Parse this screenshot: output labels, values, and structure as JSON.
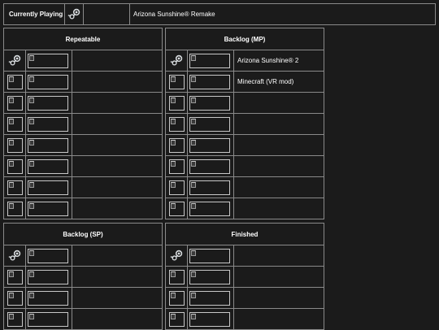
{
  "current": {
    "label": "Currently Playing",
    "icon": "steam-icon",
    "game": "Arizona Sunshine® Remake"
  },
  "sections": {
    "repeatable": {
      "title": "Repeatable",
      "rows": [
        {
          "icon": "steam-icon",
          "title": ""
        },
        {
          "icon": "image-placeholder-icon",
          "title": ""
        },
        {
          "icon": "image-placeholder-icon",
          "title": ""
        },
        {
          "icon": "image-placeholder-icon",
          "title": ""
        },
        {
          "icon": "image-placeholder-icon",
          "title": ""
        },
        {
          "icon": "image-placeholder-icon",
          "title": ""
        },
        {
          "icon": "image-placeholder-icon",
          "title": ""
        },
        {
          "icon": "image-placeholder-icon",
          "title": ""
        }
      ]
    },
    "backlog_mp": {
      "title": "Backlog (MP)",
      "rows": [
        {
          "icon": "steam-icon",
          "title": "Arizona Sunshine® 2"
        },
        {
          "icon": "image-placeholder-icon",
          "title": "Minecraft (VR mod)"
        },
        {
          "icon": "image-placeholder-icon",
          "title": ""
        },
        {
          "icon": "image-placeholder-icon",
          "title": ""
        },
        {
          "icon": "image-placeholder-icon",
          "title": ""
        },
        {
          "icon": "image-placeholder-icon",
          "title": ""
        },
        {
          "icon": "image-placeholder-icon",
          "title": ""
        },
        {
          "icon": "image-placeholder-icon",
          "title": ""
        }
      ]
    },
    "backlog_sp": {
      "title": "Backlog (SP)",
      "rows": [
        {
          "icon": "steam-icon",
          "title": ""
        },
        {
          "icon": "image-placeholder-icon",
          "title": ""
        },
        {
          "icon": "image-placeholder-icon",
          "title": ""
        },
        {
          "icon": "image-placeholder-icon",
          "title": ""
        }
      ]
    },
    "finished": {
      "title": "Finished",
      "rows": [
        {
          "icon": "steam-icon",
          "title": ""
        },
        {
          "icon": "image-placeholder-icon",
          "title": ""
        },
        {
          "icon": "image-placeholder-icon",
          "title": ""
        },
        {
          "icon": "image-placeholder-icon",
          "title": ""
        }
      ]
    }
  },
  "colors": {
    "background": "#1b1b1b",
    "border": "#8a8a8a",
    "text": "#ffffff"
  }
}
